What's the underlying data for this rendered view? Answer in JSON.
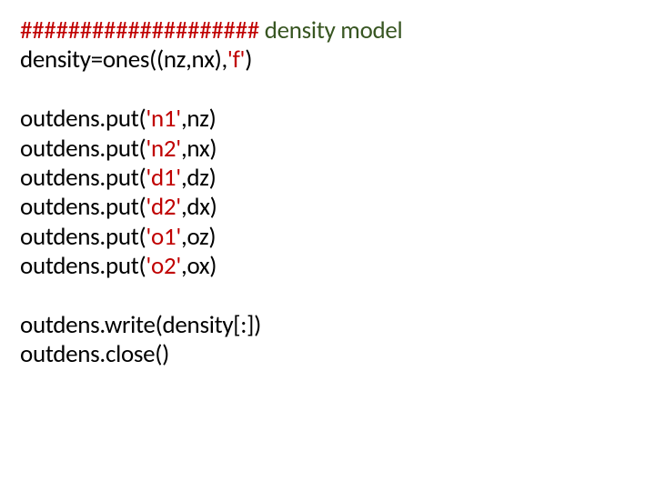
{
  "code": {
    "l1": {
      "a": "####################",
      "b": " ",
      "c": "density model"
    },
    "l2": {
      "a": "density=ones((nz,nx),",
      "b": "'f'",
      "c": ")"
    },
    "l3": {
      "a": "outdens.put(",
      "b": "'n1'",
      "c": ",nz)"
    },
    "l4": {
      "a": "outdens.put(",
      "b": "'n2'",
      "c": ",nx)"
    },
    "l5": {
      "a": "outdens.put(",
      "b": "'d1'",
      "c": ",dz)"
    },
    "l6": {
      "a": "outdens.put(",
      "b": "'d2'",
      "c": ",dx)"
    },
    "l7": {
      "a": "outdens.put(",
      "b": "'o1'",
      "c": ",oz)"
    },
    "l8": {
      "a": "outdens.put(",
      "b": "'o2'",
      "c": ",ox)"
    },
    "l9": {
      "a": "outdens.write(density[:])"
    },
    "l10": {
      "a": "outdens.close()"
    }
  }
}
